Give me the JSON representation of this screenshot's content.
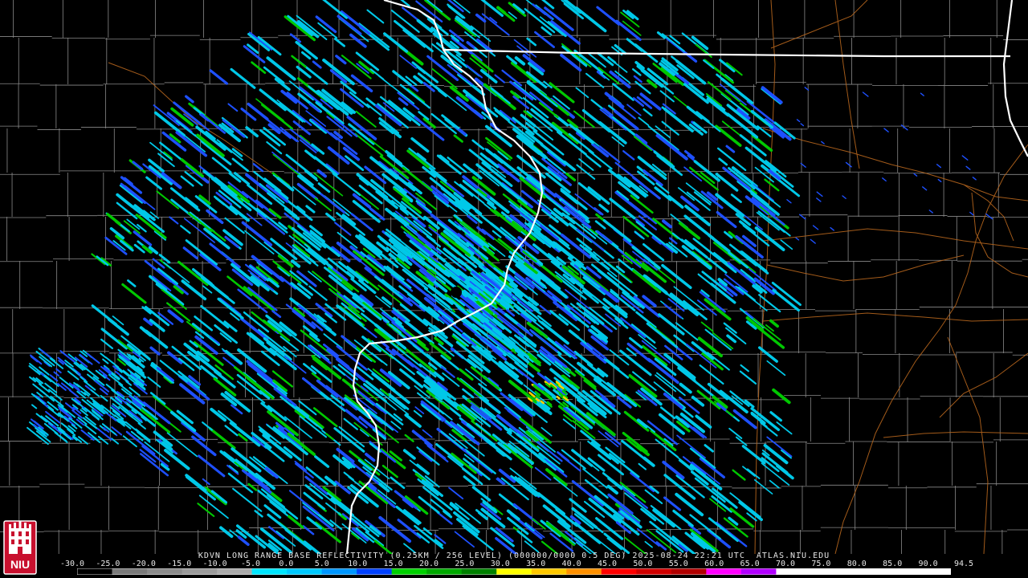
{
  "product": {
    "title": "KDVN LONG RANGE BASE REFLECTIVITY (0.25KM / 256 LEVEL) (000000/0000 0.5 DEG) 2025-08-24 22:21 UTC  ATLAS.NIU.EDU"
  },
  "logo": {
    "text": "NIU",
    "color": "#c8102e"
  },
  "legend": {
    "ticks": [
      "-30.0",
      "-25.0",
      "-20.0",
      "-15.0",
      "-10.0",
      "-5.0",
      "0.0",
      "5.0",
      "10.0",
      "15.0",
      "20.0",
      "25.0",
      "30.0",
      "35.0",
      "40.0",
      "45.0",
      "50.0",
      "55.0",
      "60.0",
      "65.0",
      "70.0",
      "75.0",
      "80.0",
      "85.0",
      "90.0",
      "94.5"
    ],
    "colors": [
      "#000000",
      "#7a7a7a",
      "#8a8a8a",
      "#9a9a9a",
      "#aaaaaa",
      "#00e5ff",
      "#00c8ff",
      "#0096ff",
      "#0040ff",
      "#00d000",
      "#00a800",
      "#008000",
      "#ffff00",
      "#ffc800",
      "#ff9000",
      "#ff0000",
      "#d00000",
      "#b00000",
      "#ff00ff",
      "#b000ff",
      "#ffffff",
      "#ffffff",
      "#ffffff",
      "#ffffff",
      "#ffffff"
    ]
  },
  "map_colors": {
    "state_border": "#ffffff",
    "county_line": "#8a8a8a",
    "highway": "#b5651d",
    "echo_light": "#00c8e8",
    "echo_medium": "#1e50ff",
    "echo_strong": "#00c800",
    "echo_heavy": "#ffd000"
  },
  "radar_site": {
    "name": "KDVN"
  }
}
